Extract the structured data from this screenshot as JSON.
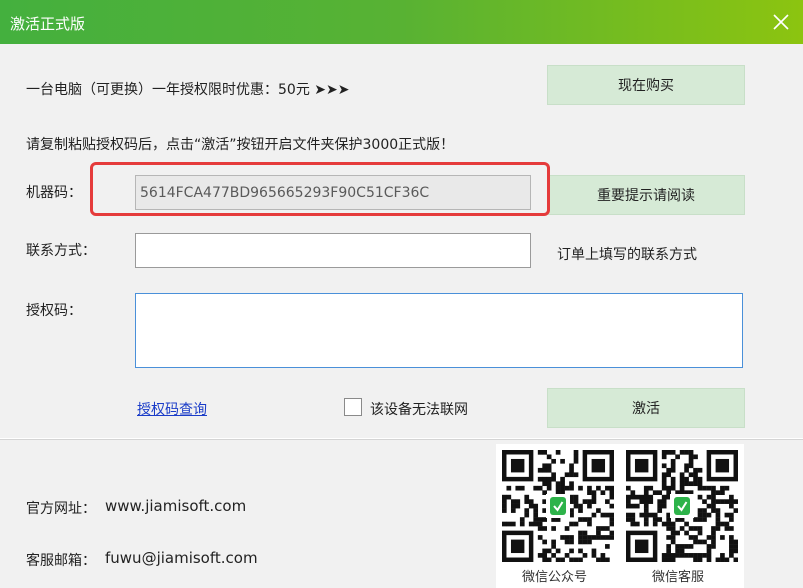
{
  "window": {
    "title": "激活正式版"
  },
  "promo": {
    "text": "一台电脑（可更换）一年授权限时优惠：50元 ➤➤➤",
    "buy_button": "现在购买"
  },
  "instruction": "请复制粘贴授权码后，点击“激活”按钮开启文件夹保护3000正式版！",
  "machine_code": {
    "label": "机器码：",
    "value": "5614FCA477BD965665293F90C51CF36C",
    "notice_button": "重要提示请阅读"
  },
  "contact": {
    "label": "联系方式：",
    "value": "",
    "hint": "订单上填写的联系方式"
  },
  "auth_code": {
    "label": "授权码：",
    "value": ""
  },
  "actions": {
    "query_link": "授权码查询",
    "offline_checkbox_label": "该设备无法联网",
    "offline_checked": false,
    "activate_button": "激活"
  },
  "footer": {
    "website_label": "官方网址：",
    "website": "www.jiamisoft.com",
    "email_label": "客服邮箱：",
    "email": "fuwu@jiamisoft.com",
    "qr_public_label": "微信公众号",
    "qr_service_label": "微信客服"
  },
  "colors": {
    "accent_green": "#58b233",
    "highlight_red": "#e53b3b",
    "link_blue": "#1a3cc8",
    "qr_badge_green": "#2db34a"
  }
}
